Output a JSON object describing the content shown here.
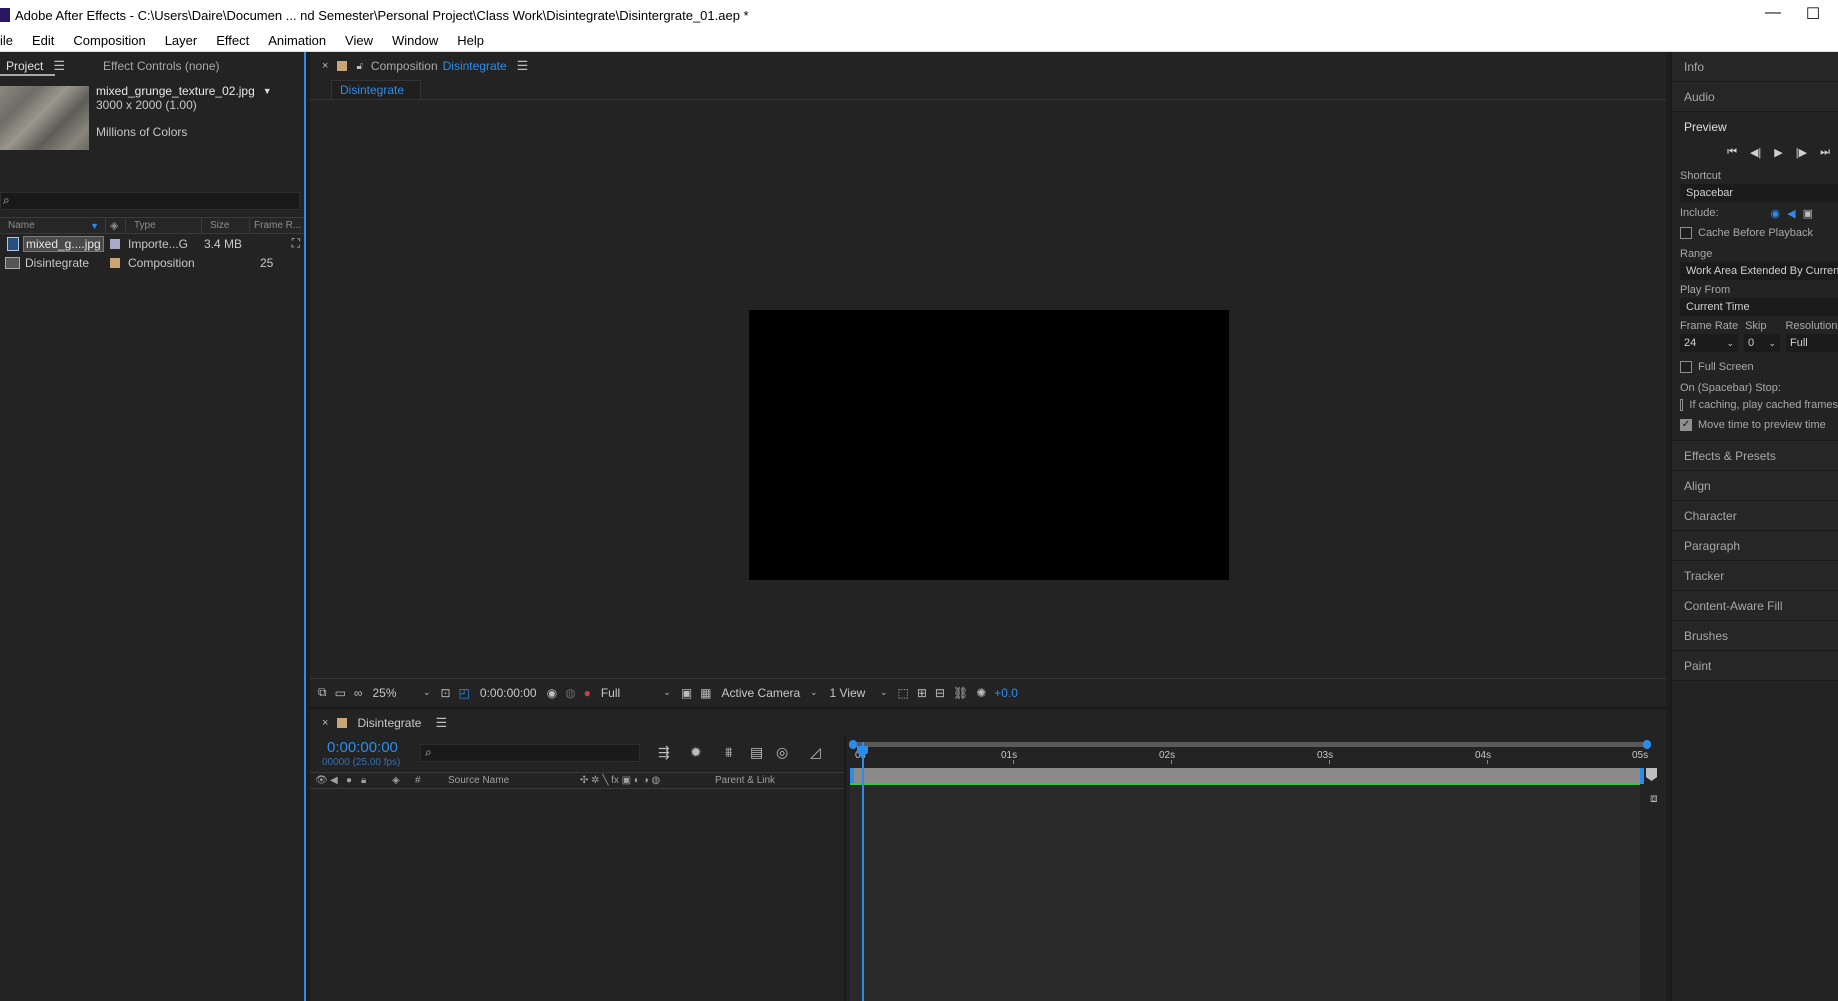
{
  "window": {
    "title": "Adobe After Effects - C:\\Users\\Daire\\Documen ... nd Semester\\Personal Project\\Class Work\\Disintegrate\\Disintergrate_01.aep *",
    "minimize": "—",
    "maximize": "☐"
  },
  "menu": [
    "ile",
    "Edit",
    "Composition",
    "Layer",
    "Effect",
    "Animation",
    "View",
    "Window",
    "Help"
  ],
  "project_panel": {
    "tab_project": "Project",
    "tab_effect_controls": "Effect Controls (none)",
    "asset": {
      "name": "mixed_grunge_texture_02.jpg",
      "dimensions": "3000 x 2000 (1.00)",
      "colors": "Millions of Colors"
    },
    "columns": {
      "name": "Name",
      "type": "Type",
      "size": "Size",
      "frame_rate": "Frame R..."
    },
    "items": [
      {
        "name": "mixed_g....jpg",
        "type": "Importe...G",
        "size": "3.4 MB",
        "frame_rate": "",
        "label_color": "#a9a9c9"
      },
      {
        "name": "Disintegrate",
        "type": "Composition",
        "size": "",
        "frame_rate": "25",
        "label_color": "#c8a675"
      }
    ]
  },
  "composition_panel": {
    "prefix": "Composition",
    "name": "Disintegrate",
    "subtab": "Disintegrate",
    "toolbar": {
      "zoom": "25%",
      "timecode": "0:00:00:00",
      "resolution": "Full",
      "camera": "Active Camera",
      "views": "1 View",
      "exposure": "+0.0"
    }
  },
  "timeline_panel": {
    "tab": "Disintegrate",
    "current_time": "0:00:00:00",
    "frames": "00000 (25.00 fps)",
    "col_source_name": "Source Name",
    "col_parent": "Parent & Link",
    "col_hash": "#",
    "ruler": [
      "0s",
      "01s",
      "02s",
      "03s",
      "04s",
      "05s"
    ]
  },
  "right_panels": {
    "info": "Info",
    "audio": "Audio",
    "preview": {
      "title": "Preview",
      "shortcut_label": "Shortcut",
      "shortcut": "Spacebar",
      "include_label": "Include:",
      "cache_before_playback": "Cache Before Playback",
      "range_label": "Range",
      "range": "Work Area Extended By Current",
      "play_from_label": "Play From",
      "play_from": "Current Time",
      "frame_rate_label": "Frame Rate",
      "skip_label": "Skip",
      "resolution_label": "Resolution",
      "frame_rate": "24",
      "skip": "0",
      "resolution": "Full",
      "full_screen": "Full Screen",
      "on_stop_label": "On (Spacebar) Stop:",
      "if_caching": "If caching, play cached frames",
      "move_time": "Move time to preview time"
    },
    "sections": [
      "Effects & Presets",
      "Align",
      "Character",
      "Paragraph",
      "Tracker",
      "Content-Aware Fill",
      "Brushes",
      "Paint"
    ]
  }
}
